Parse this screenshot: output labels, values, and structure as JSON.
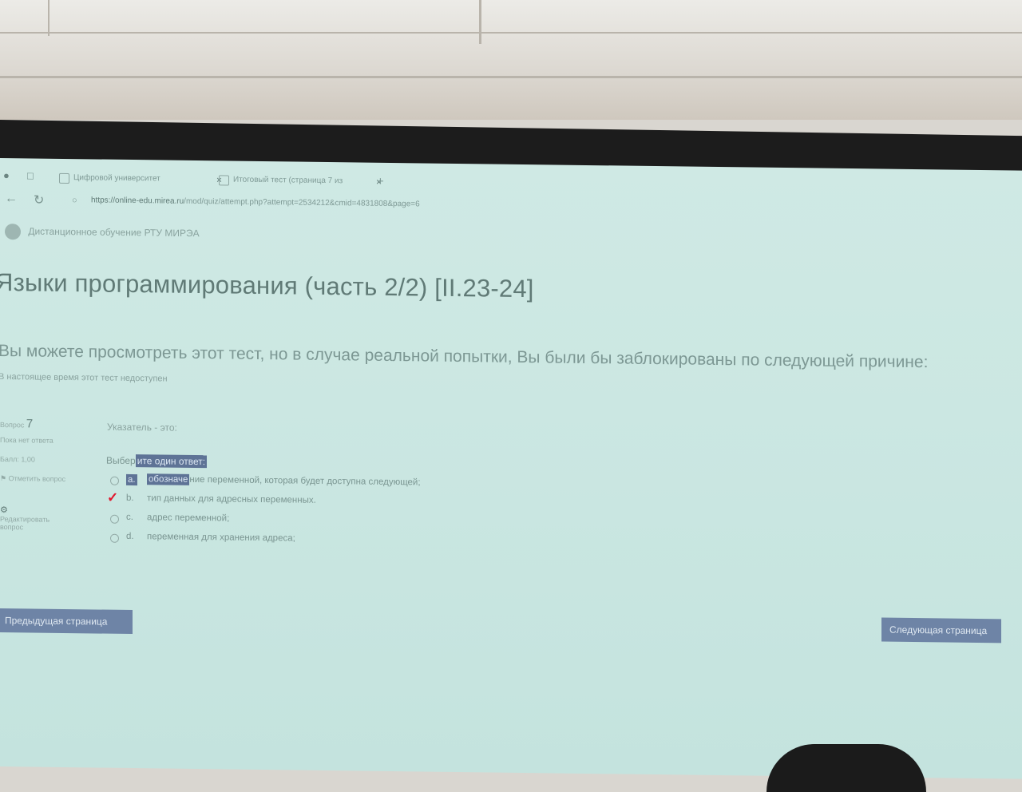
{
  "browser": {
    "tabs": [
      {
        "title": "Цифровой университет"
      },
      {
        "title": "Итоговый тест (страница 7 из"
      }
    ],
    "new_tab": "+",
    "url_host": "https://online-edu.mirea.ru",
    "url_path": "/mod/quiz/attempt.php?attempt=2534212&cmid=4831808&page=6"
  },
  "site": {
    "name": "Дистанционное обучение РТУ МИРЭА"
  },
  "course": {
    "title": "Языки программирования (часть 2/2) [II.23-24]"
  },
  "notice": {
    "main": "Вы можете просмотреть этот тест, но в случае реальной попытки, Вы были бы заблокированы по следующей причине:",
    "sub": "В настоящее время этот тест недоступен"
  },
  "question_info": {
    "label": "Вопрос",
    "number": "7",
    "status": "Пока нет ответа",
    "score": "Балл: 1,00",
    "flag": "Отметить вопрос",
    "edit": "Редактировать вопрос"
  },
  "question": {
    "text": "Указатель - это:",
    "prompt_plain": "Выбер",
    "prompt_highlight": "ите один ответ:",
    "options": [
      {
        "letter": "a.",
        "text_highlight": "обозначе",
        "text": "ние переменной, которая будет доступна следующей;"
      },
      {
        "letter": "b.",
        "text_highlight": "",
        "text": "тип данных для адресных переменных."
      },
      {
        "letter": "c.",
        "text_highlight": "",
        "text": "адрес переменной;"
      },
      {
        "letter": "d.",
        "text_highlight": "",
        "text": "переменная для хранения адреса;"
      }
    ]
  },
  "navigation": {
    "prev": "Предыдущая страница",
    "next": "Следующая страница"
  },
  "colors": {
    "screen": "#cbe7e2",
    "button": "#6e84a6",
    "selection": "#5e7396",
    "check_mark": "#e1162c"
  }
}
